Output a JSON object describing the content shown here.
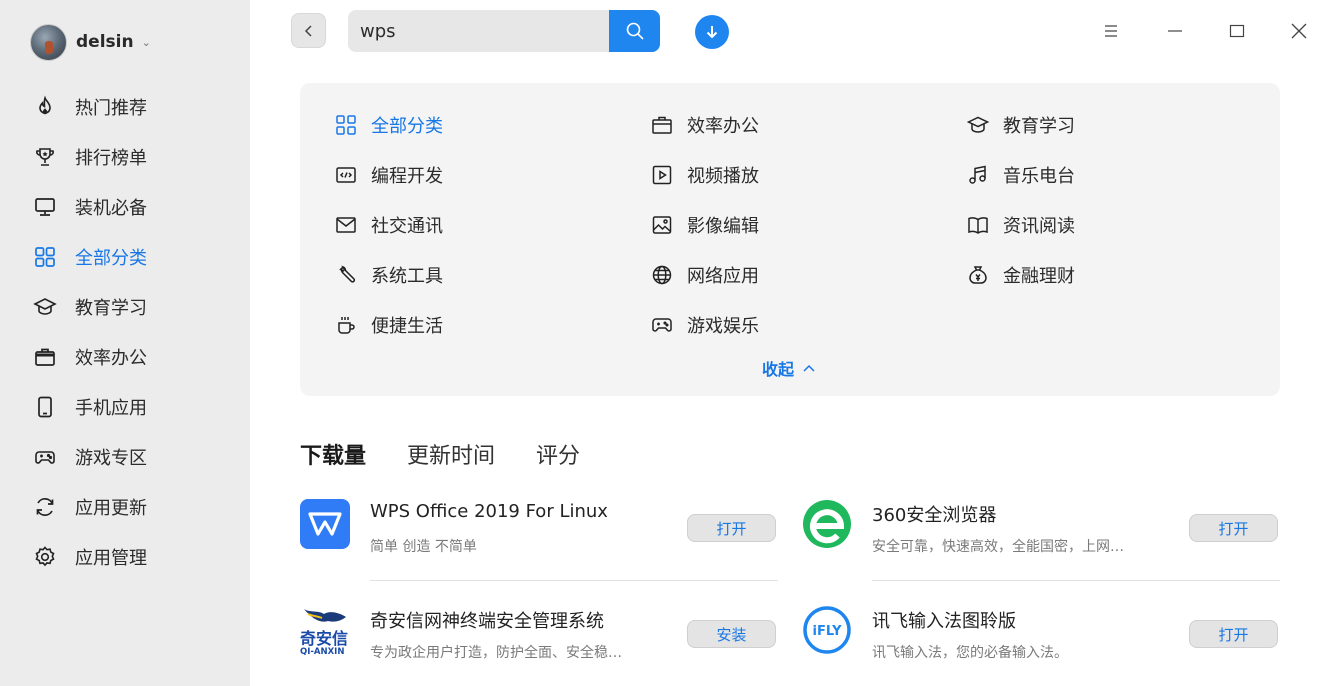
{
  "user": {
    "name": "delsin",
    "caret": "⌄"
  },
  "nav": {
    "items": [
      {
        "label": "热门推荐",
        "icon": "flame-icon"
      },
      {
        "label": "排行榜单",
        "icon": "trophy-icon"
      },
      {
        "label": "装机必备",
        "icon": "monitor-icon"
      },
      {
        "label": "全部分类",
        "icon": "grid-icon",
        "active": true
      },
      {
        "label": "教育学习",
        "icon": "graduation-cap-icon"
      },
      {
        "label": "效率办公",
        "icon": "briefcase-icon"
      },
      {
        "label": "手机应用",
        "icon": "phone-icon"
      },
      {
        "label": "游戏专区",
        "icon": "gamepad-icon"
      },
      {
        "label": "应用更新",
        "icon": "refresh-icon"
      },
      {
        "label": "应用管理",
        "icon": "gear-icon"
      }
    ]
  },
  "search": {
    "value": "wps"
  },
  "categories": [
    {
      "label": "全部分类",
      "icon": "grid-icon",
      "active": true
    },
    {
      "label": "效率办公",
      "icon": "briefcase-icon"
    },
    {
      "label": "教育学习",
      "icon": "graduation-cap-icon"
    },
    {
      "label": "编程开发",
      "icon": "code-icon"
    },
    {
      "label": "视频播放",
      "icon": "play-icon"
    },
    {
      "label": "音乐电台",
      "icon": "music-icon"
    },
    {
      "label": "社交通讯",
      "icon": "mail-icon"
    },
    {
      "label": "影像编辑",
      "icon": "image-icon"
    },
    {
      "label": "资讯阅读",
      "icon": "book-icon"
    },
    {
      "label": "系统工具",
      "icon": "wrench-icon"
    },
    {
      "label": "网络应用",
      "icon": "globe-icon"
    },
    {
      "label": "金融理财",
      "icon": "money-bag-icon"
    },
    {
      "label": "便捷生活",
      "icon": "cup-icon"
    },
    {
      "label": "游戏娱乐",
      "icon": "gamepad-icon"
    }
  ],
  "collapse_label": "收起",
  "sort_tabs": [
    {
      "label": "下载量",
      "active": true
    },
    {
      "label": "更新时间"
    },
    {
      "label": "评分"
    }
  ],
  "apps": [
    {
      "name": "WPS Office 2019 For Linux",
      "desc": "简单 创造 不简单",
      "button": "打开",
      "icon": "wps-logo-icon"
    },
    {
      "name": "360安全浏览器",
      "desc": "安全可靠，快速高效，全能国密，上网…",
      "button": "打开",
      "icon": "360-browser-logo-icon"
    },
    {
      "name": "奇安信网神终端安全管理系统",
      "desc": "专为政企用户打造，防护全面、安全稳…",
      "button": "安装",
      "icon": "qianxin-logo-icon",
      "logo_text": [
        "奇安信",
        "QI-ANXIN"
      ]
    },
    {
      "name": "讯飞输入法图聆版",
      "desc": "讯飞输入法，您的必备输入法。",
      "button": "打开",
      "icon": "ifly-logo-icon",
      "logo_text": "iFLY"
    }
  ],
  "colors": {
    "accent": "#1f86f0",
    "sidebar_bg": "#ececec",
    "panel_bg": "#f4f4f4",
    "wps_blue": "#2f7cf6",
    "browser_green": "#1fb85c"
  }
}
